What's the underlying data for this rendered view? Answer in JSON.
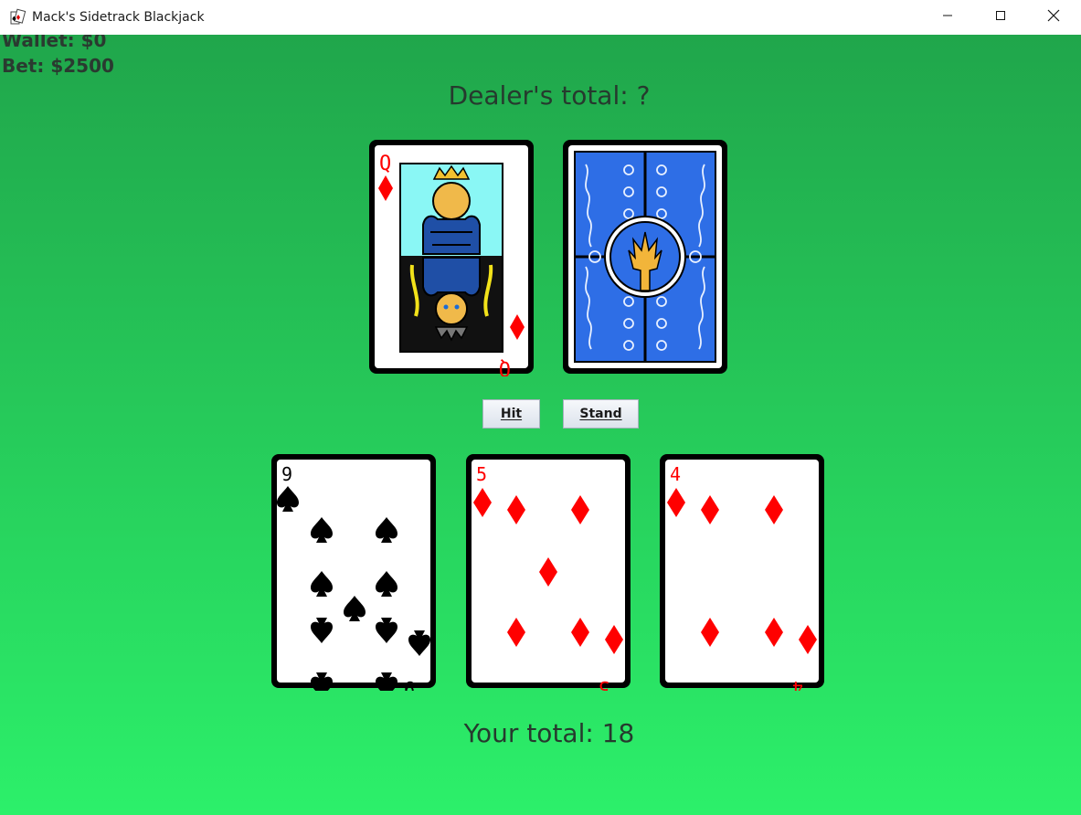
{
  "window": {
    "title": "Mack's Sidetrack Blackjack",
    "controls": [
      "minimize-icon",
      "maximize-icon",
      "close-icon"
    ]
  },
  "hud": {
    "wallet": "Wallet: $0",
    "bet": "Bet: $2500"
  },
  "dealer": {
    "total_label": "Dealer's total: ?",
    "cards": [
      {
        "rank": "Q",
        "suit": "diamonds",
        "color": "#ff0000",
        "face_up": true
      },
      {
        "face_up": false,
        "back_color": "#2e6ee6"
      }
    ]
  },
  "actions": {
    "hit_label": "Hit",
    "stand_label": "Stand"
  },
  "player": {
    "total_label": "Your total: 18",
    "cards": [
      {
        "rank": "9",
        "suit": "spades",
        "color": "#000000"
      },
      {
        "rank": "5",
        "suit": "diamonds",
        "color": "#ff0000"
      },
      {
        "rank": "4",
        "suit": "diamonds",
        "color": "#ff0000"
      }
    ]
  },
  "colors": {
    "table_top": "#20a64b",
    "table_bottom": "#2cf06a",
    "text": "#263a2e"
  }
}
